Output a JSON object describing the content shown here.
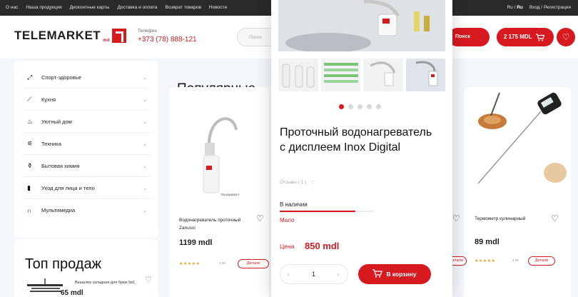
{
  "topbar": {
    "links": [
      "О нас",
      "Наша продукция",
      "Дисконтные карты",
      "Доставка и оплата",
      "Возврат товаров",
      "Новости"
    ],
    "lang_ru": "Ru",
    "lang_sep": "/",
    "lang_ro": "Ru",
    "auth": "Вход / Регистрация"
  },
  "header": {
    "logo_text": "TELEMARKET",
    "logo_suffix": "md",
    "phone_label": "Телефон",
    "phone_number": "+373 (78) 888-121",
    "search_placeholder": "Поиск",
    "search_button": "Поиск",
    "cart_total": "2 175 MDL"
  },
  "sidebar": {
    "items": [
      {
        "label": "Спорт-здоровье",
        "icon": "dumbbell-icon"
      },
      {
        "label": "Кухня",
        "icon": "knife-icon"
      },
      {
        "label": "Уютный дом",
        "icon": "sofa-icon"
      },
      {
        "label": "Техника",
        "icon": "gadget-icon"
      },
      {
        "label": "Бытовая химия",
        "icon": "spray-bottle-icon"
      },
      {
        "label": "Уход для лица и тело",
        "icon": "cosmetics-icon"
      },
      {
        "label": "Мультимедиа",
        "icon": "headphones-icon"
      }
    ]
  },
  "top_sales": {
    "title": "Топ продаж",
    "item_name": "Вешалка складная для брюк 5в1",
    "item_price": "65 mdl"
  },
  "popular": {
    "title": "Популярные"
  },
  "card1": {
    "name": "Водонагреватель проточный Zanussi",
    "price": "1199 mdl",
    "rating": "4.99",
    "details": "Детали"
  },
  "card2": {
    "name": "Термометр кулинарный",
    "price": "89 mdl",
    "rating": "4.99",
    "details": "Детали",
    "ghost_details": "Детали"
  },
  "modal": {
    "title": "Проточный водонагреватель с дисплеем Inox Digital",
    "reviews_label": "Отзывы ( 1 )",
    "stock_label": "В наличии",
    "stock_level": 0.8,
    "low_label": "Мало",
    "price_label": "Цена",
    "price_value": "850 mdl",
    "quantity": "1",
    "add_to_cart": "В корзину",
    "dots_total": 5,
    "dots_active": 0
  },
  "colors": {
    "brand_red": "#d71920",
    "topbar_bg": "#2a2a2a",
    "star": "#e99d1c"
  }
}
